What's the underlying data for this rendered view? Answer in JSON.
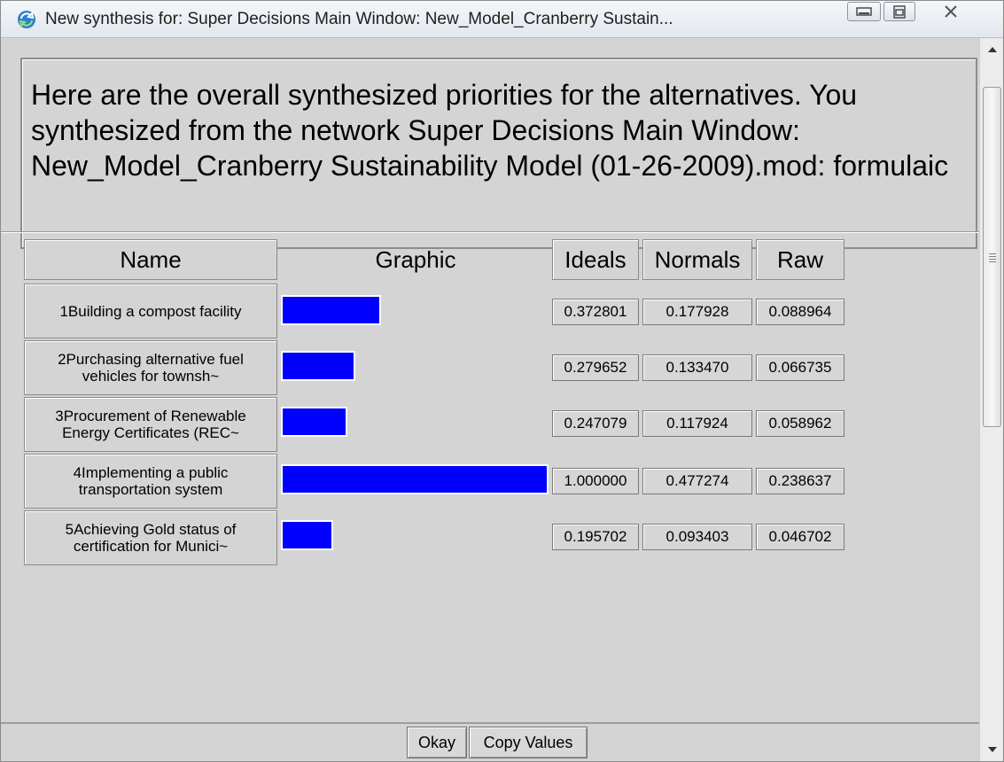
{
  "window": {
    "title": "New synthesis for: Super Decisions Main Window: New_Model_Cranberry Sustain..."
  },
  "message": "Here are the overall synthesized priorities for the alternatives.  You synthesized from the network Super Decisions Main Window: New_Model_Cranberry Sustainability Model (01-26-2009).mod: formulaic",
  "table": {
    "headers": {
      "name": "Name",
      "graphic": "Graphic",
      "ideals": "Ideals",
      "normals": "Normals",
      "raw": "Raw"
    },
    "rows": [
      {
        "name": "1Building a compost facility",
        "ideal_value": 0.372801,
        "ideals": "0.372801",
        "normals": "0.177928",
        "raw": "0.088964"
      },
      {
        "name": "2Purchasing alternative fuel vehicles for townsh~",
        "ideal_value": 0.279652,
        "ideals": "0.279652",
        "normals": "0.133470",
        "raw": "0.066735"
      },
      {
        "name": "3Procurement of Renewable Energy Certificates (REC~",
        "ideal_value": 0.247079,
        "ideals": "0.247079",
        "normals": "0.117924",
        "raw": "0.058962"
      },
      {
        "name": "4Implementing a public transportation system",
        "ideal_value": 1.0,
        "ideals": "1.000000",
        "normals": "0.477274",
        "raw": "0.238637"
      },
      {
        "name": "5Achieving Gold status of certification for Munici~",
        "ideal_value": 0.195702,
        "ideals": "0.195702",
        "normals": "0.093403",
        "raw": "0.046702"
      }
    ]
  },
  "buttons": {
    "okay": "Okay",
    "copy_values": "Copy Values"
  },
  "colors": {
    "bar": "#0000ff",
    "background": "#d4d4d4"
  },
  "icons": {
    "app": "refresh-icon",
    "minimize": "minimize-icon",
    "maximize": "maximize-icon",
    "close": "close-icon"
  }
}
